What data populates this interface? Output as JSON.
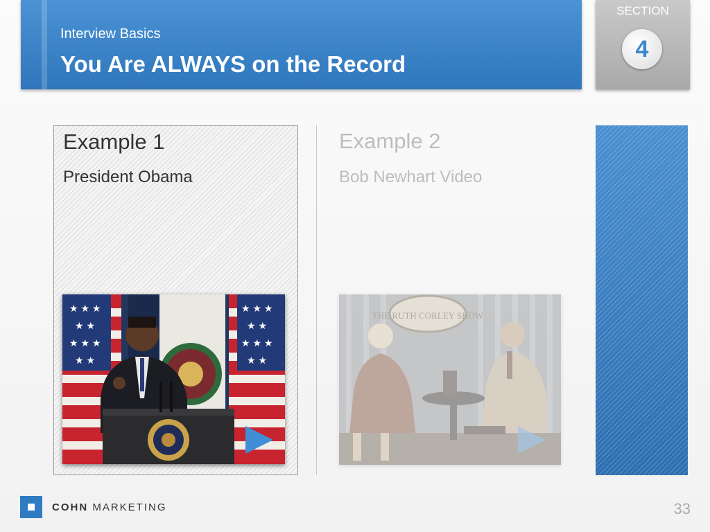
{
  "header": {
    "subtitle": "Interview Basics",
    "title": "You Are ALWAYS on the Record"
  },
  "section": {
    "label": "SECTION",
    "number": "4"
  },
  "examples": [
    {
      "title": "Example 1",
      "subtitle": "President Obama"
    },
    {
      "title": "Example 2",
      "subtitle": "Bob Newhart Video"
    }
  ],
  "footer": {
    "brand_bold": "COHN",
    "brand_rest": "MARKETING",
    "page_number": "33"
  },
  "colors": {
    "accent": "#3b86cc",
    "header_blue": "#3f86c9"
  }
}
